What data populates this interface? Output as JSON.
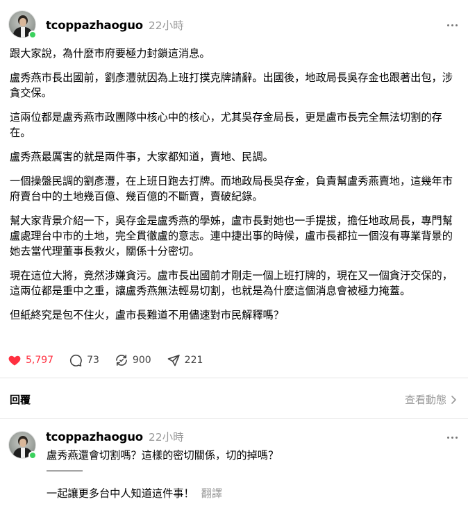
{
  "post": {
    "username": "tcoppazhaoguo",
    "timestamp": "22小時",
    "paragraphs": [
      "跟大家說，為什麼市府要極力封鎖這消息。",
      "盧秀燕市長出國前，劉彥灃就因為上班打撲克牌請辭。出國後，地政局長吳存金也跟著出包，涉貪交保。",
      "這兩位都是盧秀燕市政團隊中核心中的核心，尤其吳存金局長，更是盧市長完全無法切割的存在。",
      "盧秀燕最厲害的就是兩件事，大家都知道，賣地、民調。",
      "一個操盤民調的劉彥灃，在上班日跑去打牌。而地政局長吳存金，負責幫盧秀燕賣地，這幾年市府賣台中的土地幾百億、幾百億的不斷賣，賣破紀錄。",
      "幫大家背景介紹一下，吳存金是盧秀燕的學姊，盧市長對她也一手提拔，擔任地政局長，專門幫盧處理台中市的土地，完全貫徹盧的意志。連中捷出事的時候，盧市長都拉一個沒有專業背景的她去當代理董事長救火，關係十分密切。",
      "現在這位大將，竟然涉嫌貪污。盧市長出國前才剛走一個上班打牌的，現在又一個貪汙交保的，這兩位都是重中之重，讓盧秀燕無法輕易切割，也就是為什麼這個消息會被極力掩蓋。",
      "但紙終究是包不住火，盧市長難道不用儘速對市民解釋嗎？"
    ],
    "actions": {
      "likes": "5,797",
      "comments": "73",
      "reposts": "900",
      "shares": "221"
    }
  },
  "replies_header": {
    "label": "回覆",
    "view_activity": "查看動態"
  },
  "reply": {
    "username": "tcoppazhaoguo",
    "timestamp": "22小時",
    "line1": "盧秀燕還會切割嗎？這樣的密切關係，切的掉嗎？",
    "line2": "一起讓更多台中人知道這件事！",
    "translate": "翻譯"
  },
  "colors": {
    "like_red": "#ff3040",
    "online_green": "#3bd15d",
    "muted_gray": "#999999"
  },
  "icons": [
    "heart-icon",
    "comment-icon",
    "repost-icon",
    "share-icon",
    "more-icon",
    "chevron-right-icon"
  ]
}
